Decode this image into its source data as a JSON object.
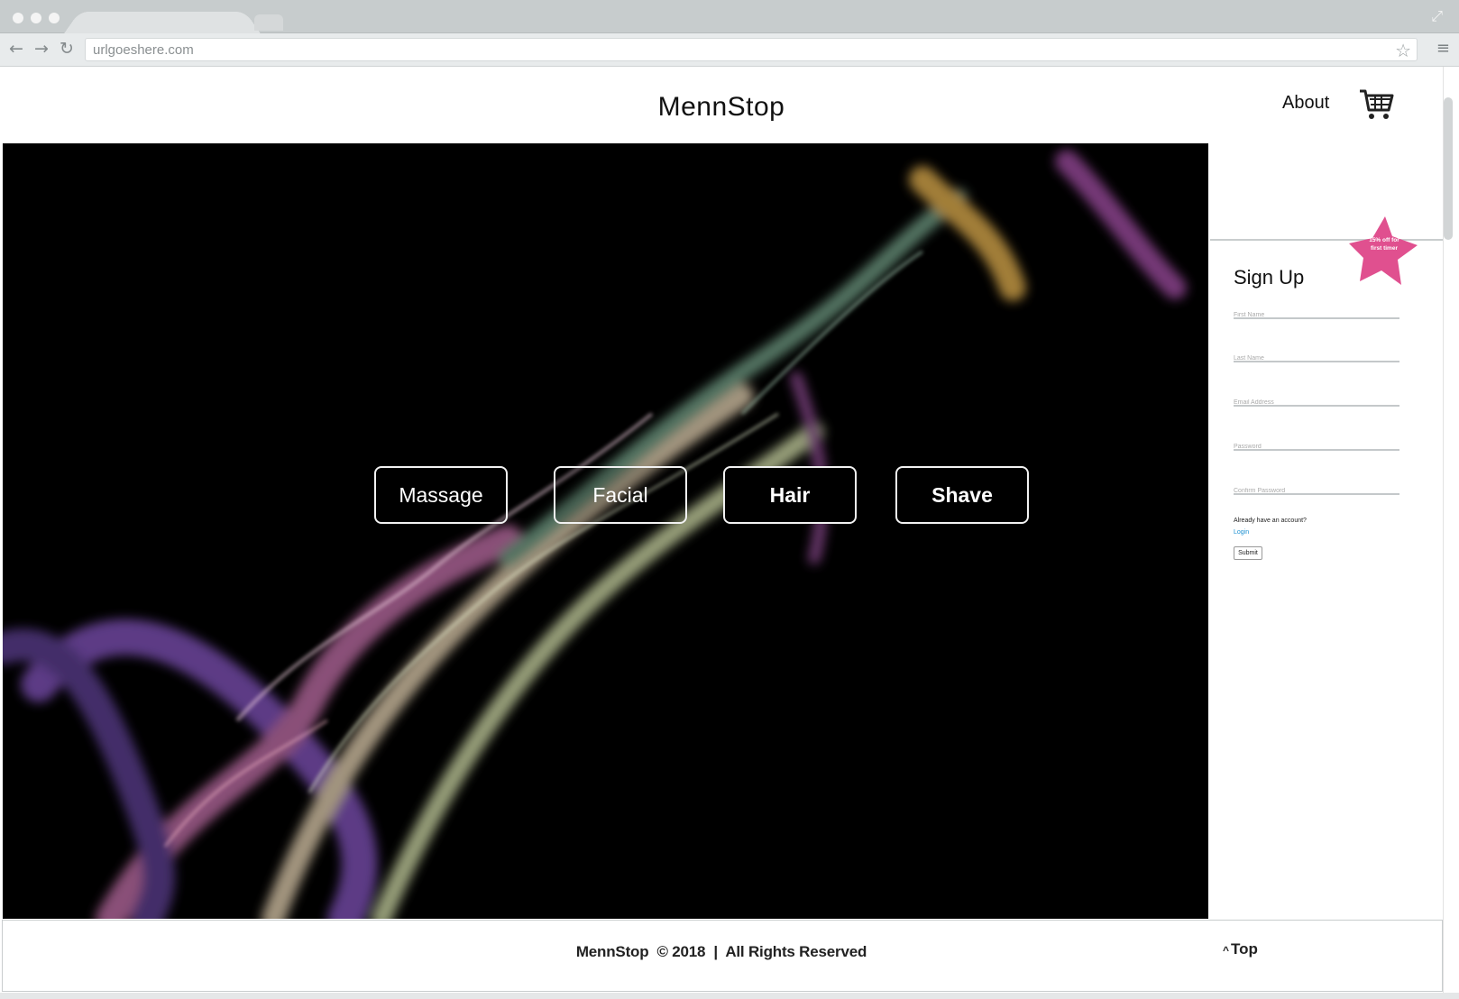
{
  "browser": {
    "url": "urlgoeshere.com",
    "icons": [
      "back-arrow-icon",
      "forward-arrow-icon",
      "reload-icon",
      "bookmark-star-icon",
      "menu-icon",
      "expand-icon"
    ]
  },
  "header": {
    "brand": "MennStop",
    "nav_about": "About",
    "cart_icon": "shopping-cart-icon"
  },
  "hero": {
    "services": [
      "Massage",
      "Facial",
      "Hair",
      "Shave"
    ]
  },
  "signup": {
    "title": "Sign Up",
    "promo": "15% off for first timer",
    "fields": {
      "first_name": "First Name",
      "last_name": "Last Name",
      "email": "Email Address",
      "password": "Password",
      "confirm_password": "Confirm Password"
    },
    "already_text": "Already have an account?",
    "login_label": "Login",
    "submit_label": "Submit"
  },
  "footer": {
    "text": "MennStop  © 2018  |  All Rights Reserved",
    "top_label": "Top"
  },
  "colors": {
    "promo_star": "#e0508f",
    "link": "#1a8fd1",
    "hero_bg": "#000000"
  }
}
